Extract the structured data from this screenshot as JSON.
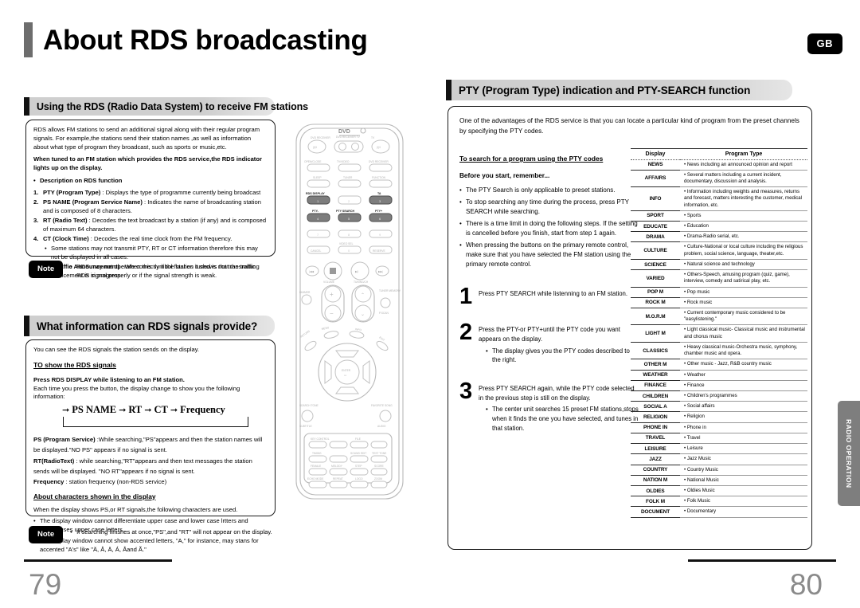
{
  "header": {
    "title": "About RDS broadcasting",
    "region_badge": "GB"
  },
  "side_tab": {
    "label": "RADIO OPERATION"
  },
  "footer": {
    "page_left": "79",
    "page_right": "80"
  },
  "left_page": {
    "section1": {
      "heading": "Using the RDS (Radio Data System) to receive FM stations",
      "intro": "RDS allows FM stations to send an additional signal along with their regular program signals. For example,the stations send their station names ,as well as information about what  type of program they broadcast, such as sports or music,etc.",
      "bold_note": "When tuned to an FM station which provides the RDS service,the RDS indicator lights up on the display.",
      "sub_head": "Description on RDS function",
      "items": [
        {
          "n": "1.",
          "term": "PTY (Program Type)",
          "desc": " : Displays the type of programme currently being broadcast"
        },
        {
          "n": "2.",
          "term": "PS NAME (Program Service Name)",
          "desc": " : Indicates the name of broadcasting station and is composed of 8 characters."
        },
        {
          "n": "3.",
          "term": "RT (Radio Text)",
          "desc": " : Decodes the text broadcast by a station (if any) and is composed of maximum 64 characters."
        },
        {
          "n": "4.",
          "term": "CT (Clock Time)",
          "desc": " : Decodes the real time clock from the FM frequency."
        },
        {
          "n": "5.",
          "term": "TA (Traffic Announcement)",
          "desc": " : When this symbol flashes it shows that the traffic announcement is in progress."
        }
      ],
      "sub_bullet_after_4": "Some stations may not transmit PTY, RT or CT information therefore this may not be displayed in all cases.",
      "note_label": "Note",
      "note_text": "RDS may not operate correctly if the station tuned is not transmitting RDS signal properly or if the signal strength is weak."
    },
    "section2": {
      "heading": "What information can RDS signals provide?",
      "intro": "You can see the RDS signals the station sends on the display.",
      "sub_head1": "TO show the RDS signals",
      "bold_line": "Press RDS DISPLAY while listening to an FM station.",
      "plain_line": "Each time you press the button, the display change to show you the following information:",
      "flow": [
        "PS NAME",
        "RT",
        "CT",
        "Frequency"
      ],
      "defs": [
        {
          "term": "PS (Program Service)",
          "desc": " :While searching,\"PS\"appears and then the station names will be displayed.\"NO PS\" appears if no signal is sent."
        },
        {
          "term": "RT(RadioText)",
          "desc": " : while searching,\"RT\"appears and then text messages the station sends will be displayed. \"NO RT\"appears if no signal is sent."
        },
        {
          "term": "Frequency",
          "desc": " : station frequency (non-RDS service)"
        }
      ],
      "sub_head2": "About characters shown in the display",
      "chars_intro": "When the display shows PS,or RT signals,the following characters are used.",
      "chars_bullets": [
        "The display window cannot differentiate upper case and lower case lrtters and always uses upper case letters.",
        "The display window  cannot show accented letters, \"A,\" for instance, may stans for accented \"A's\" like \"Ä, Å, Ä, Á, Åand Ã.\""
      ],
      "note_label": "Note",
      "note_text": "If searching finishes at once,\"PS\",and \"RT\" will not appear on the display."
    },
    "remote": {
      "brand": "DVD",
      "top_labels": [
        "DVD RECEIVER",
        "DVD RECEIVER   TV",
        "TV"
      ],
      "rows": [
        [
          "OPEN/CLOSE",
          "TV/VIDEO",
          "DVD RECEIVER"
        ],
        [
          "SLEEP",
          "TUNER",
          "FUNCTION"
        ],
        [
          "RDS DISPLAY",
          "",
          "TA"
        ],
        [
          "PTY-",
          "PTY SEARCH",
          "PTY+"
        ],
        [
          "",
          "",
          ""
        ],
        [
          "CANCEL",
          "VIDEO SEL",
          "RESERVE"
        ]
      ],
      "highlighted": [
        "RDS DISPLAY",
        "TA",
        "PTY-",
        "PTY SEARCH",
        "PTY+"
      ],
      "center_label": "ENTER",
      "knob_labels": [
        "VOLUME",
        "TUNING/CH"
      ],
      "side_labels": [
        "DIMMER",
        "TUNER MEMORY",
        "P.SCAN",
        "MENU",
        "INFO",
        "RETURN",
        "EXIT",
        "SEARCH TONE",
        "FAVORITE SONG",
        "SUBTITLE",
        "AUDIO"
      ],
      "pad_labels": [
        "KEY CONTROL",
        "FILE",
        "TIMING",
        "SOUND EDIT",
        "TEST TONE",
        "FEMALE",
        "MELODY",
        "STEP",
        "SCORE",
        "ECHO MODE",
        "MODE",
        "REPEAT",
        "MALE",
        "LOGO",
        "ZOOM"
      ]
    }
  },
  "right_page": {
    "section": {
      "heading": "PTY (Program Type) indication and PTY-SEARCH function",
      "intro": "One  of the advantages of the RDS service is that you can locate a particular kind of program from the preset channels by specifying the PTY codes.",
      "sub_head": "To search for a program using the PTY codes",
      "before_head": "Before you start, remember...",
      "before_bullets": [
        "The PTY Search is only applicable to preset stations.",
        "To stop searching any time during the process, press PTY SEARCH while searching.",
        "There is a time limit in doing the following steps. If the setting is cancelled before you finish, start from step 1 again.",
        "When pressing the buttons on the primary remote control, make sure that you have selected the FM station using the primary remote control."
      ],
      "steps": [
        {
          "n": "1",
          "text": "Press PTY SEARCH while listenning to an FM station.",
          "bullets": []
        },
        {
          "n": "2",
          "text": "Press the PTY-or PTY+until the PTY code you want appears on the display.",
          "bullets": [
            "The display gives you the PTY codes described to the right."
          ]
        },
        {
          "n": "3",
          "text": "Press PTY SEARCH again, while the PTY code selected in the previous step is still on the display.",
          "bullets": [
            "The center unit searches 15 preset FM stations,stops when it finds the one you have selected, and tunes in that station."
          ]
        }
      ]
    },
    "pty_table": {
      "columns": [
        "Display",
        "Program Type"
      ],
      "rows": [
        {
          "display": "NEWS",
          "type": "News including an announced opinion and report"
        },
        {
          "display": "AFFAIRS",
          "type": "Several matters including a current incident, documentary, discussion and analysis."
        },
        {
          "display": "INFO",
          "type": "Information including weights and measures, returns and forecast, matters interesting the customer, medical information, etc."
        },
        {
          "display": "SPORT",
          "type": "Sports"
        },
        {
          "display": "EDUCATE",
          "type": "Education"
        },
        {
          "display": "DRAMA",
          "type": "Drama-Radio serial, etc."
        },
        {
          "display": "CULTURE",
          "type": "Culture-National or local culture including the religious problem, social science, language, theater,etc."
        },
        {
          "display": "SCIENCE",
          "type": "Natural science and technology"
        },
        {
          "display": "VARIED",
          "type": "Others-Speech, amusing program (quiz, game), interview, comedy and satirical play, etc."
        },
        {
          "display": "POP M",
          "type": "Pop music"
        },
        {
          "display": "ROCK M",
          "type": "Rock music"
        },
        {
          "display": "M.O.R.M",
          "type": "Current contemporary music considered to be \"easylistening.\""
        },
        {
          "display": "LIGHT M",
          "type": "Light classical music- Classical music and instrumental and chorus music"
        },
        {
          "display": "CLASSICS",
          "type": "Heavy classical  music-Orchestra music, symphony, chamber music and opera."
        },
        {
          "display": "OTHER M",
          "type": "Other music - Jazz, R&B country music"
        },
        {
          "display": "WEATHER",
          "type": "Weather"
        },
        {
          "display": "FINANCE",
          "type": "Finance"
        },
        {
          "display": "CHILDREN",
          "type": "Children's programmes"
        },
        {
          "display": "SOCIAL A",
          "type": "Social affairs"
        },
        {
          "display": "RELIGION",
          "type": "Religion"
        },
        {
          "display": "PHONE IN",
          "type": "Phone in"
        },
        {
          "display": "TRAVEL",
          "type": "Travel"
        },
        {
          "display": "LEISURE",
          "type": "Leisure"
        },
        {
          "display": "JAZZ",
          "type": "Jazz Music"
        },
        {
          "display": "COUNTRY",
          "type": "Country Music"
        },
        {
          "display": "NATION M",
          "type": "National Music"
        },
        {
          "display": "OLDIES",
          "type": "Oldies Music"
        },
        {
          "display": "FOLK M",
          "type": "Folk Music"
        },
        {
          "display": "DOCUMENT",
          "type": "Documentary"
        }
      ]
    }
  }
}
